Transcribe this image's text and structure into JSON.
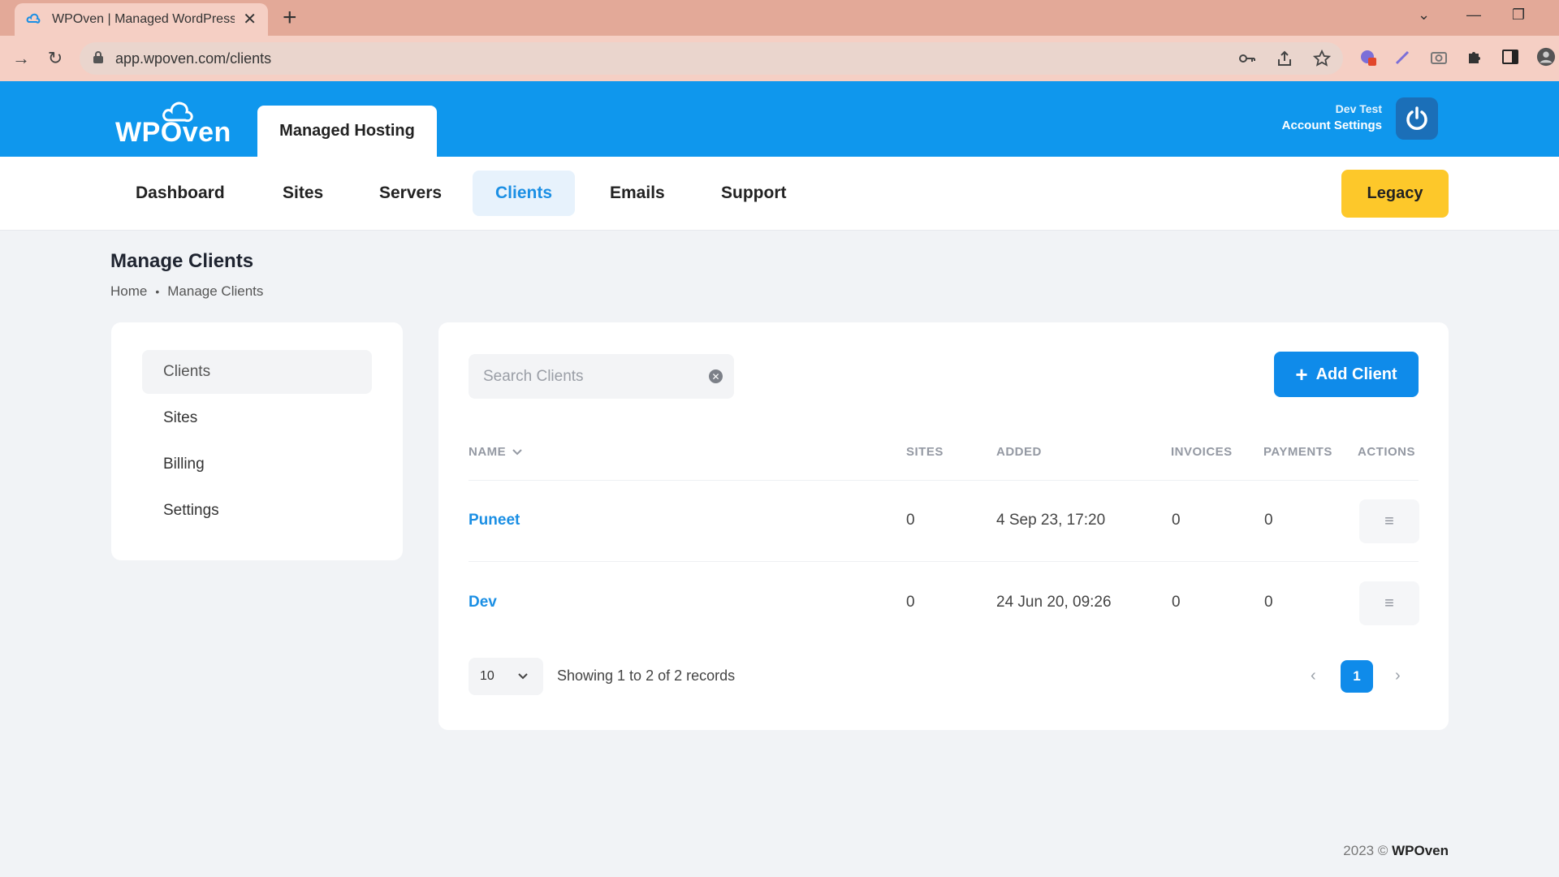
{
  "browser": {
    "tab_title": "WPOven | Managed WordPress H",
    "url": "app.wpoven.com/clients"
  },
  "header": {
    "logo_text": "WPOven",
    "product_tab": "Managed Hosting",
    "account_name": "Dev Test",
    "account_settings": "Account Settings"
  },
  "nav": {
    "items": [
      {
        "label": "Dashboard"
      },
      {
        "label": "Sites"
      },
      {
        "label": "Servers"
      },
      {
        "label": "Clients",
        "active": true
      },
      {
        "label": "Emails"
      },
      {
        "label": "Support"
      }
    ],
    "legacy_label": "Legacy"
  },
  "page": {
    "title": "Manage Clients",
    "breadcrumb": [
      "Home",
      "Manage Clients"
    ]
  },
  "sidebar": {
    "items": [
      {
        "label": "Clients",
        "active": true
      },
      {
        "label": "Sites"
      },
      {
        "label": "Billing"
      },
      {
        "label": "Settings"
      }
    ]
  },
  "clients": {
    "search_placeholder": "Search Clients",
    "add_button": "Add Client",
    "columns": [
      "NAME",
      "SITES",
      "ADDED",
      "INVOICES",
      "PAYMENTS",
      "ACTIONS"
    ],
    "rows": [
      {
        "name": "Puneet",
        "sites": "0",
        "added": "4 Sep 23, 17:20",
        "invoices": "0",
        "payments": "0"
      },
      {
        "name": "Dev",
        "sites": "0",
        "added": "24 Jun 20, 09:26",
        "invoices": "0",
        "payments": "0"
      }
    ],
    "per_page": "10",
    "showing": "Showing 1 to 2 of 2 records",
    "current_page": "1"
  },
  "footer": {
    "year": "2023 ©",
    "brand": "WPOven"
  },
  "colors": {
    "brand_blue": "#0f97ed",
    "legacy_yellow": "#fdc82a",
    "link_blue": "#1b8fe4"
  }
}
